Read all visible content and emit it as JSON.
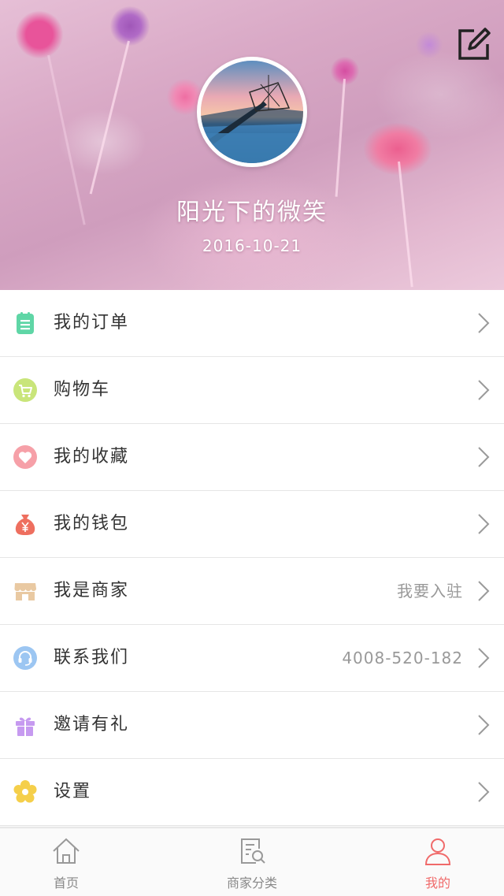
{
  "profile": {
    "username": "阳光下的微笑",
    "date": "2016-10-21"
  },
  "menu": [
    {
      "label": "我的订单",
      "icon": "order-list-icon",
      "color": "#5fd6a6",
      "value": ""
    },
    {
      "label": "购物车",
      "icon": "shopping-cart-icon",
      "color": "#c9e57a",
      "value": ""
    },
    {
      "label": "我的收藏",
      "icon": "heart-icon",
      "color": "#f6a0a8",
      "value": ""
    },
    {
      "label": "我的钱包",
      "icon": "money-bag-icon",
      "color": "#ee6f5f",
      "value": ""
    },
    {
      "label": "我是商家",
      "icon": "shop-icon",
      "color": "#e9c9a2",
      "value": "我要入驻"
    },
    {
      "label": "联系我们",
      "icon": "headset-icon",
      "color": "#9cc6f2",
      "value": "4008-520-182"
    },
    {
      "label": "邀请有礼",
      "icon": "gift-icon",
      "color": "#c69af0",
      "value": ""
    },
    {
      "label": "设置",
      "icon": "settings-flower-icon",
      "color": "#f5cf4a",
      "value": ""
    }
  ],
  "tabs": [
    {
      "label": "首页",
      "icon": "home-icon",
      "active": false
    },
    {
      "label": "商家分类",
      "icon": "category-search-icon",
      "active": false
    },
    {
      "label": "我的",
      "icon": "user-icon",
      "active": true
    }
  ],
  "colors": {
    "accent": "#f06a6a",
    "tab_inactive": "#888888",
    "menu_text": "#333333",
    "menu_value": "#999999"
  }
}
